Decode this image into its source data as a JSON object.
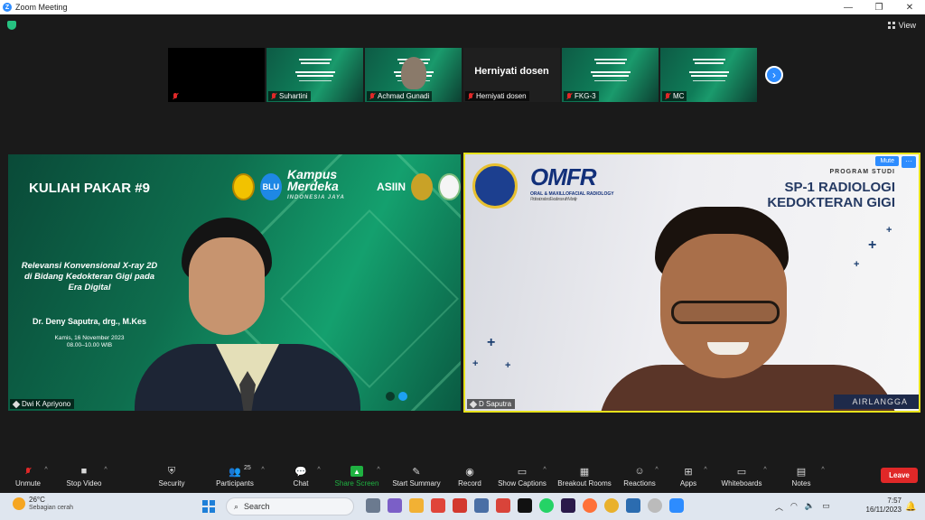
{
  "window": {
    "title": "Zoom Meeting",
    "controls": [
      "—",
      "❐",
      "✕"
    ]
  },
  "meeting": {
    "view_label": "View"
  },
  "strip": [
    {
      "name": "",
      "type": "black"
    },
    {
      "name": "Suhartini",
      "type": "slide"
    },
    {
      "name": "Achmad Gunadi",
      "type": "slide"
    },
    {
      "name": "Herniyati dosen",
      "type": "plain",
      "bigname": "Herniyati dosen"
    },
    {
      "name": "FKG-3",
      "type": "slide"
    },
    {
      "name": "MC",
      "type": "slide"
    }
  ],
  "left_video": {
    "name": "Dwi K Apriyono",
    "title": "KULIAH PAKAR #9",
    "topic": "Relevansi Konvensional X-ray 2D di Bidang Kedokteran Gigi pada Era Digital",
    "speaker": "Dr. Deny Saputra, drg., M.Kes",
    "date": "Kamis, 16 November 2023",
    "time": "08.00–10.00 WIB",
    "logo_blu": "BLU",
    "logo_kampus": "Kampus Merdeka",
    "logo_kampus_sub": "INDONESIA JAYA",
    "logo_asiin": "ASIIN"
  },
  "right_video": {
    "name": "D Saputra",
    "mute_label": "Mute",
    "more_label": "···",
    "omfr": "OMFR",
    "omfr_sub": "ORAL & MAXILLOFACIAL RADIOLOGY",
    "omfr_tag": "Professional and Excellence with Morality",
    "program": "PROGRAM STUDI",
    "program_title": "SP-1 RADIOLOGI KEDOKTERAN GIGI",
    "footer": "AIRLANGGA"
  },
  "toolbar": {
    "unmute": "Unmute",
    "stop_video": "Stop Video",
    "security": "Security",
    "participants": "Participants",
    "participants_count": "25",
    "chat": "Chat",
    "share_screen": "Share Screen",
    "start_summary": "Start Summary",
    "record": "Record",
    "show_captions": "Show Captions",
    "breakout_rooms": "Breakout Rooms",
    "reactions": "Reactions",
    "apps": "Apps",
    "whiteboards": "Whiteboards",
    "notes": "Notes",
    "leave": "Leave"
  },
  "taskbar": {
    "temp": "26°C",
    "weather": "Sebagian cerah",
    "search": "Search",
    "time": "7:57",
    "date": "16/11/2023"
  },
  "colors": {
    "accent": "#2d8cff",
    "share_green": "#1fb141",
    "leave_red": "#e02828",
    "active_border": "#e7e21b"
  }
}
